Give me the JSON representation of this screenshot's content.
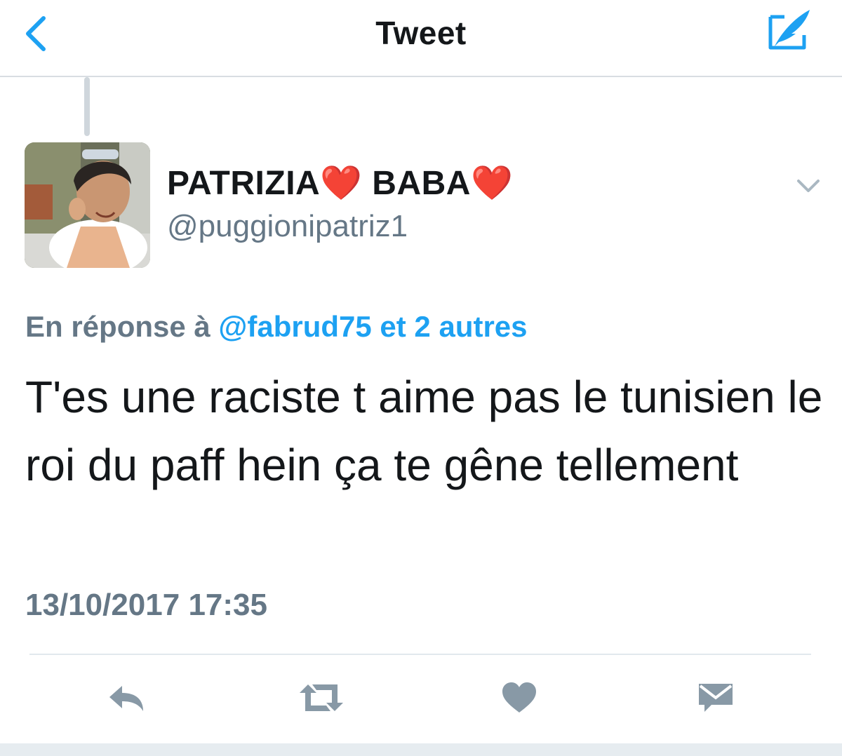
{
  "nav": {
    "title": "Tweet"
  },
  "tweet": {
    "display_name": "PATRIZIA❤️ BABA❤️",
    "handle": "@puggionipatriz1",
    "reply_prefix": "En réponse à ",
    "reply_mention": "@fabrud75 et 2 autres",
    "text": "T'es une raciste t aime pas le tunisien le roi du paff hein ça te gêne tellement",
    "timestamp": "13/10/2017 17:35"
  },
  "icons": {
    "back": "chevron-left-icon",
    "compose": "compose-quill-icon",
    "caret": "chevron-down-icon",
    "reply": "reply-icon",
    "retweet": "retweet-icon",
    "like": "heart-icon",
    "dm": "envelope-icon"
  },
  "colors": {
    "accent": "#1da1f2",
    "text": "#14171a",
    "secondary": "#657786",
    "icon_gray": "#8899a6"
  }
}
